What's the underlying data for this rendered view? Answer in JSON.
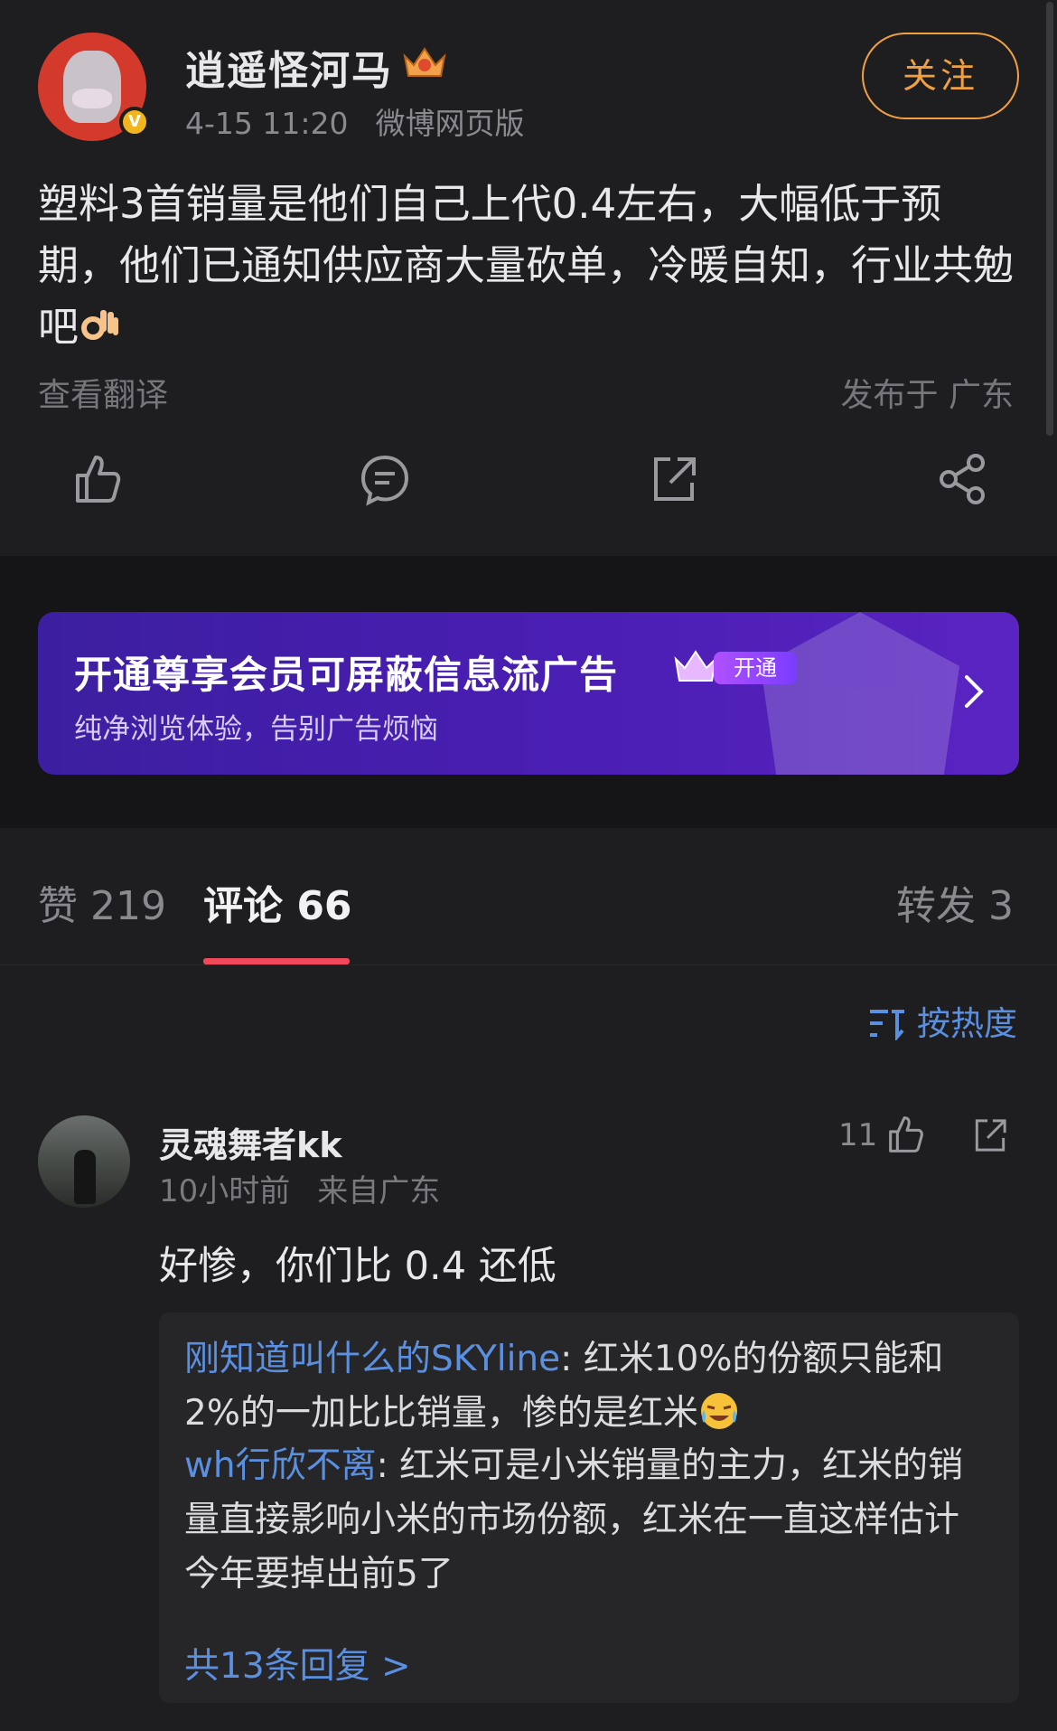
{
  "post": {
    "author": "逍遥怪河马",
    "time": "4-15 11:20",
    "source": "微博网页版",
    "follow_label": "关注",
    "text": "塑料3首销量是他们自己上代0.4左右，大幅低于预期，他们已通知供应商大量砍单，冷暖自知，行业共勉吧",
    "translate_label": "查看翻译",
    "location": "发布于 广东",
    "verified_badge": "V",
    "action_icons": [
      "thumbs-up-icon",
      "comment-icon",
      "repost-icon",
      "share-icon"
    ]
  },
  "ad": {
    "title": "开通尊享会员可屏蔽信息流广告",
    "badge": "开通",
    "subtitle": "纯净浏览体验，告别广告烦恼"
  },
  "tabs": {
    "likes": "赞 219",
    "comments": "评论 66",
    "reposts": "转发 3"
  },
  "sort": {
    "label": "按热度"
  },
  "comment": {
    "author": "灵魂舞者kk",
    "time": "10小时前",
    "from": "来自广东",
    "likes": "11",
    "text": "好惨，你们比 0.4 还低",
    "replies": [
      {
        "who": "刚知道叫什么的SKYline",
        "text": ": 红米10%的份额只能和2%的一加比比销量，惨的是红米"
      },
      {
        "who": "wh行欣不离",
        "text": ": 红米可是小米销量的主力，红米的销量直接影响小米的市场份额，红米在一直这样估计今年要掉出前5了"
      }
    ],
    "more_label": "共13条回复 >"
  },
  "colors": {
    "accent_orange": "#f0a040",
    "link_blue": "#5b8fe0",
    "tab_underline": "#f04a5a",
    "ad_purple": "#4a1eb3"
  }
}
